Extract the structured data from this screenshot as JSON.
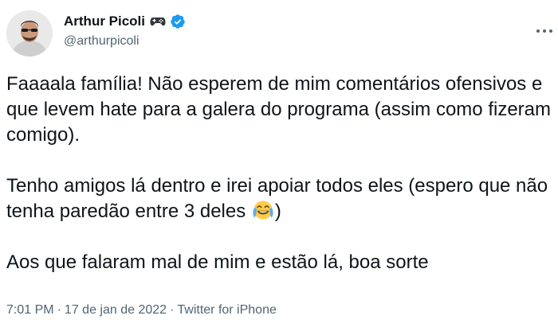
{
  "author": {
    "display_name": "Arthur Picoli",
    "handle": "@arthurpicoli",
    "verified": true,
    "name_emoji": "video-game-controller-icon"
  },
  "tweet": {
    "paragraphs": [
      {
        "text": "Faaaala família! Não esperem de mim comentários ofensivos e que levem hate para a galera do programa (assim como fizeram comigo)."
      },
      {
        "text_before_emoji": "Tenho amigos lá dentro e irei apoiar todos eles (espero que não tenha paredão entre 3 deles ",
        "emoji": "laughing-crying-face-icon",
        "text_after_emoji": ")"
      },
      {
        "text": "Aos que falaram mal de mim e estão lá, boa sorte"
      }
    ]
  },
  "meta": {
    "time": "7:01 PM",
    "date": "17 de jan de 2022",
    "source": "Twitter for iPhone",
    "separator": "·"
  },
  "colors": {
    "text": "#0f1419",
    "secondary": "#536471",
    "verified": "#1d9bf0",
    "background": "#ffffff"
  }
}
